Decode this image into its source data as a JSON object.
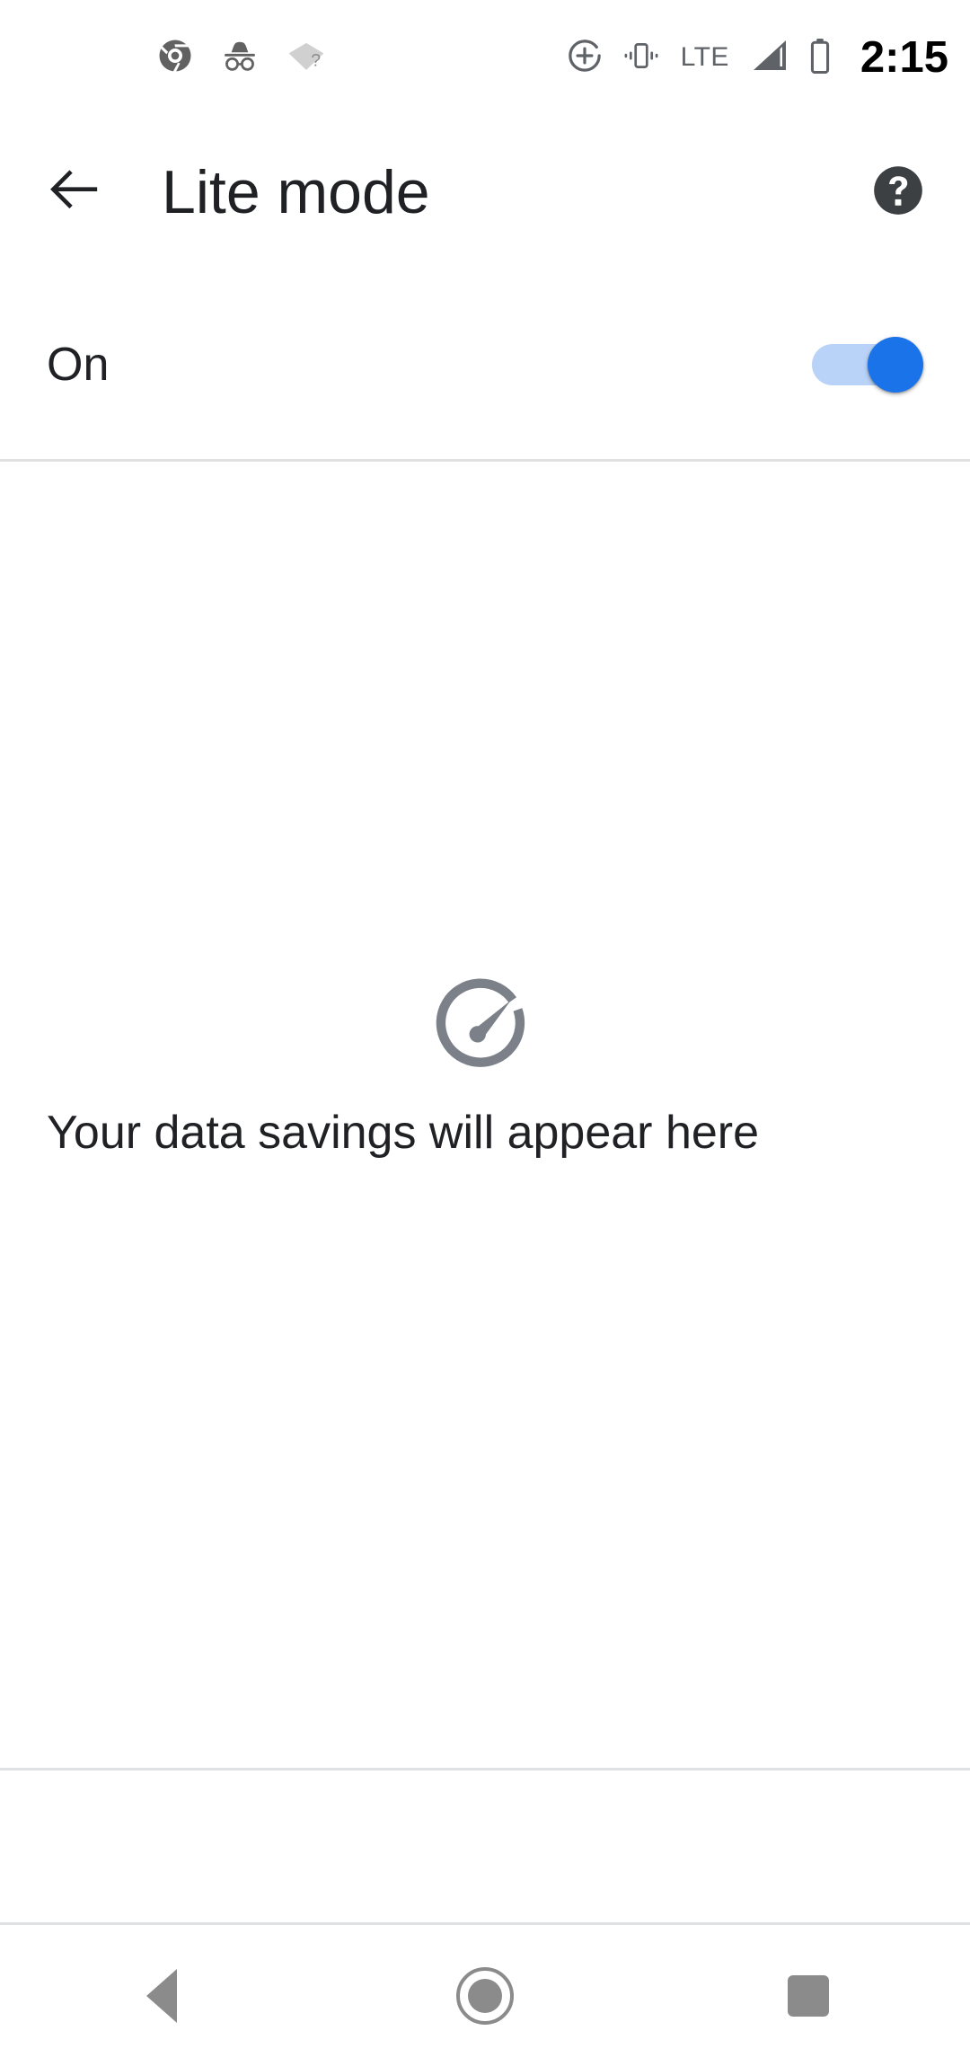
{
  "status_bar": {
    "left_icons": [
      {
        "name": "chrome-icon",
        "label": "Chrome"
      },
      {
        "name": "incognito-icon",
        "label": "Incognito"
      },
      {
        "name": "wifi-question-icon",
        "label": "Wi-Fi no internet"
      }
    ],
    "right_icons": [
      {
        "name": "location-add-icon",
        "label": "Location"
      },
      {
        "name": "vibrate-icon",
        "label": "Vibrate"
      },
      {
        "name": "signal-icon",
        "label": "Mobile signal"
      },
      {
        "name": "battery-icon",
        "label": "Battery"
      }
    ],
    "network_type": "LTE",
    "clock": "2:15"
  },
  "app_bar": {
    "back_icon": "arrow-back-icon",
    "title": "Lite mode",
    "help_icon": "help-circle-icon"
  },
  "toggle_row": {
    "label": "On",
    "state": "on",
    "track_color": "#b9d2f8",
    "thumb_color": "#1a73e8"
  },
  "empty_state": {
    "icon": "speedometer-icon",
    "icon_color": "#7c8088",
    "message": "Your data savings will appear here"
  },
  "nav_bar": {
    "back_label": "Back",
    "home_label": "Home",
    "recents_label": "Recents",
    "icon_color": "#8b8b8b"
  },
  "colors": {
    "background": "#ffffff",
    "text_primary": "#202124",
    "text_secondary": "#5f6368",
    "divider": "#e0e1e3",
    "accent": "#1a73e8"
  }
}
